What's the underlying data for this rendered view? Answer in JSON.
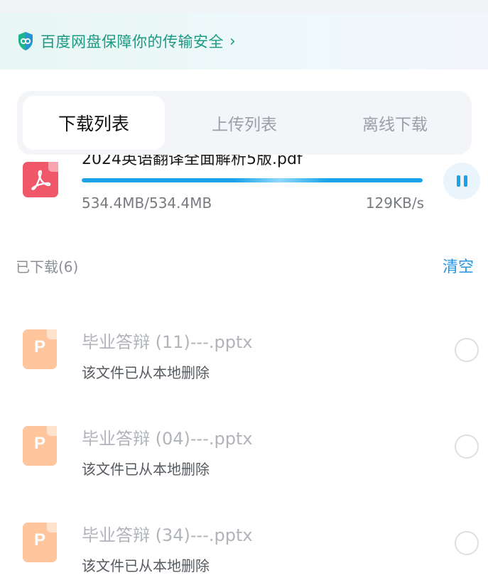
{
  "banner": {
    "text": "百度网盘保障你的传输安全",
    "chevron": "›",
    "icon": "shield-icon",
    "color": "#1b9a83"
  },
  "tabs": [
    {
      "label": "下载列表",
      "active": true
    },
    {
      "label": "上传列表",
      "active": false
    },
    {
      "label": "离线下载",
      "active": false
    }
  ],
  "downloading": {
    "name": "2024英语翻译全面解析5版.pdf",
    "icon": "pdf-icon",
    "progress": 1.0,
    "size": "534.4MB/534.4MB",
    "speed": "129KB/s",
    "pause_icon": "pause-icon",
    "accent": "#1aa3e8"
  },
  "downloaded": {
    "title": "已下载(6)",
    "clear_label": "清空",
    "accent": "#2196e8",
    "items": [
      {
        "name": "毕业答辩 (11)---.pptx",
        "status": "该文件已从本地删除",
        "icon_letter": "P"
      },
      {
        "name": "毕业答辩 (04)---.pptx",
        "status": "该文件已从本地删除",
        "icon_letter": "P"
      },
      {
        "name": "毕业答辩 (34)---.pptx",
        "status": "该文件已从本地删除",
        "icon_letter": "P"
      }
    ]
  }
}
